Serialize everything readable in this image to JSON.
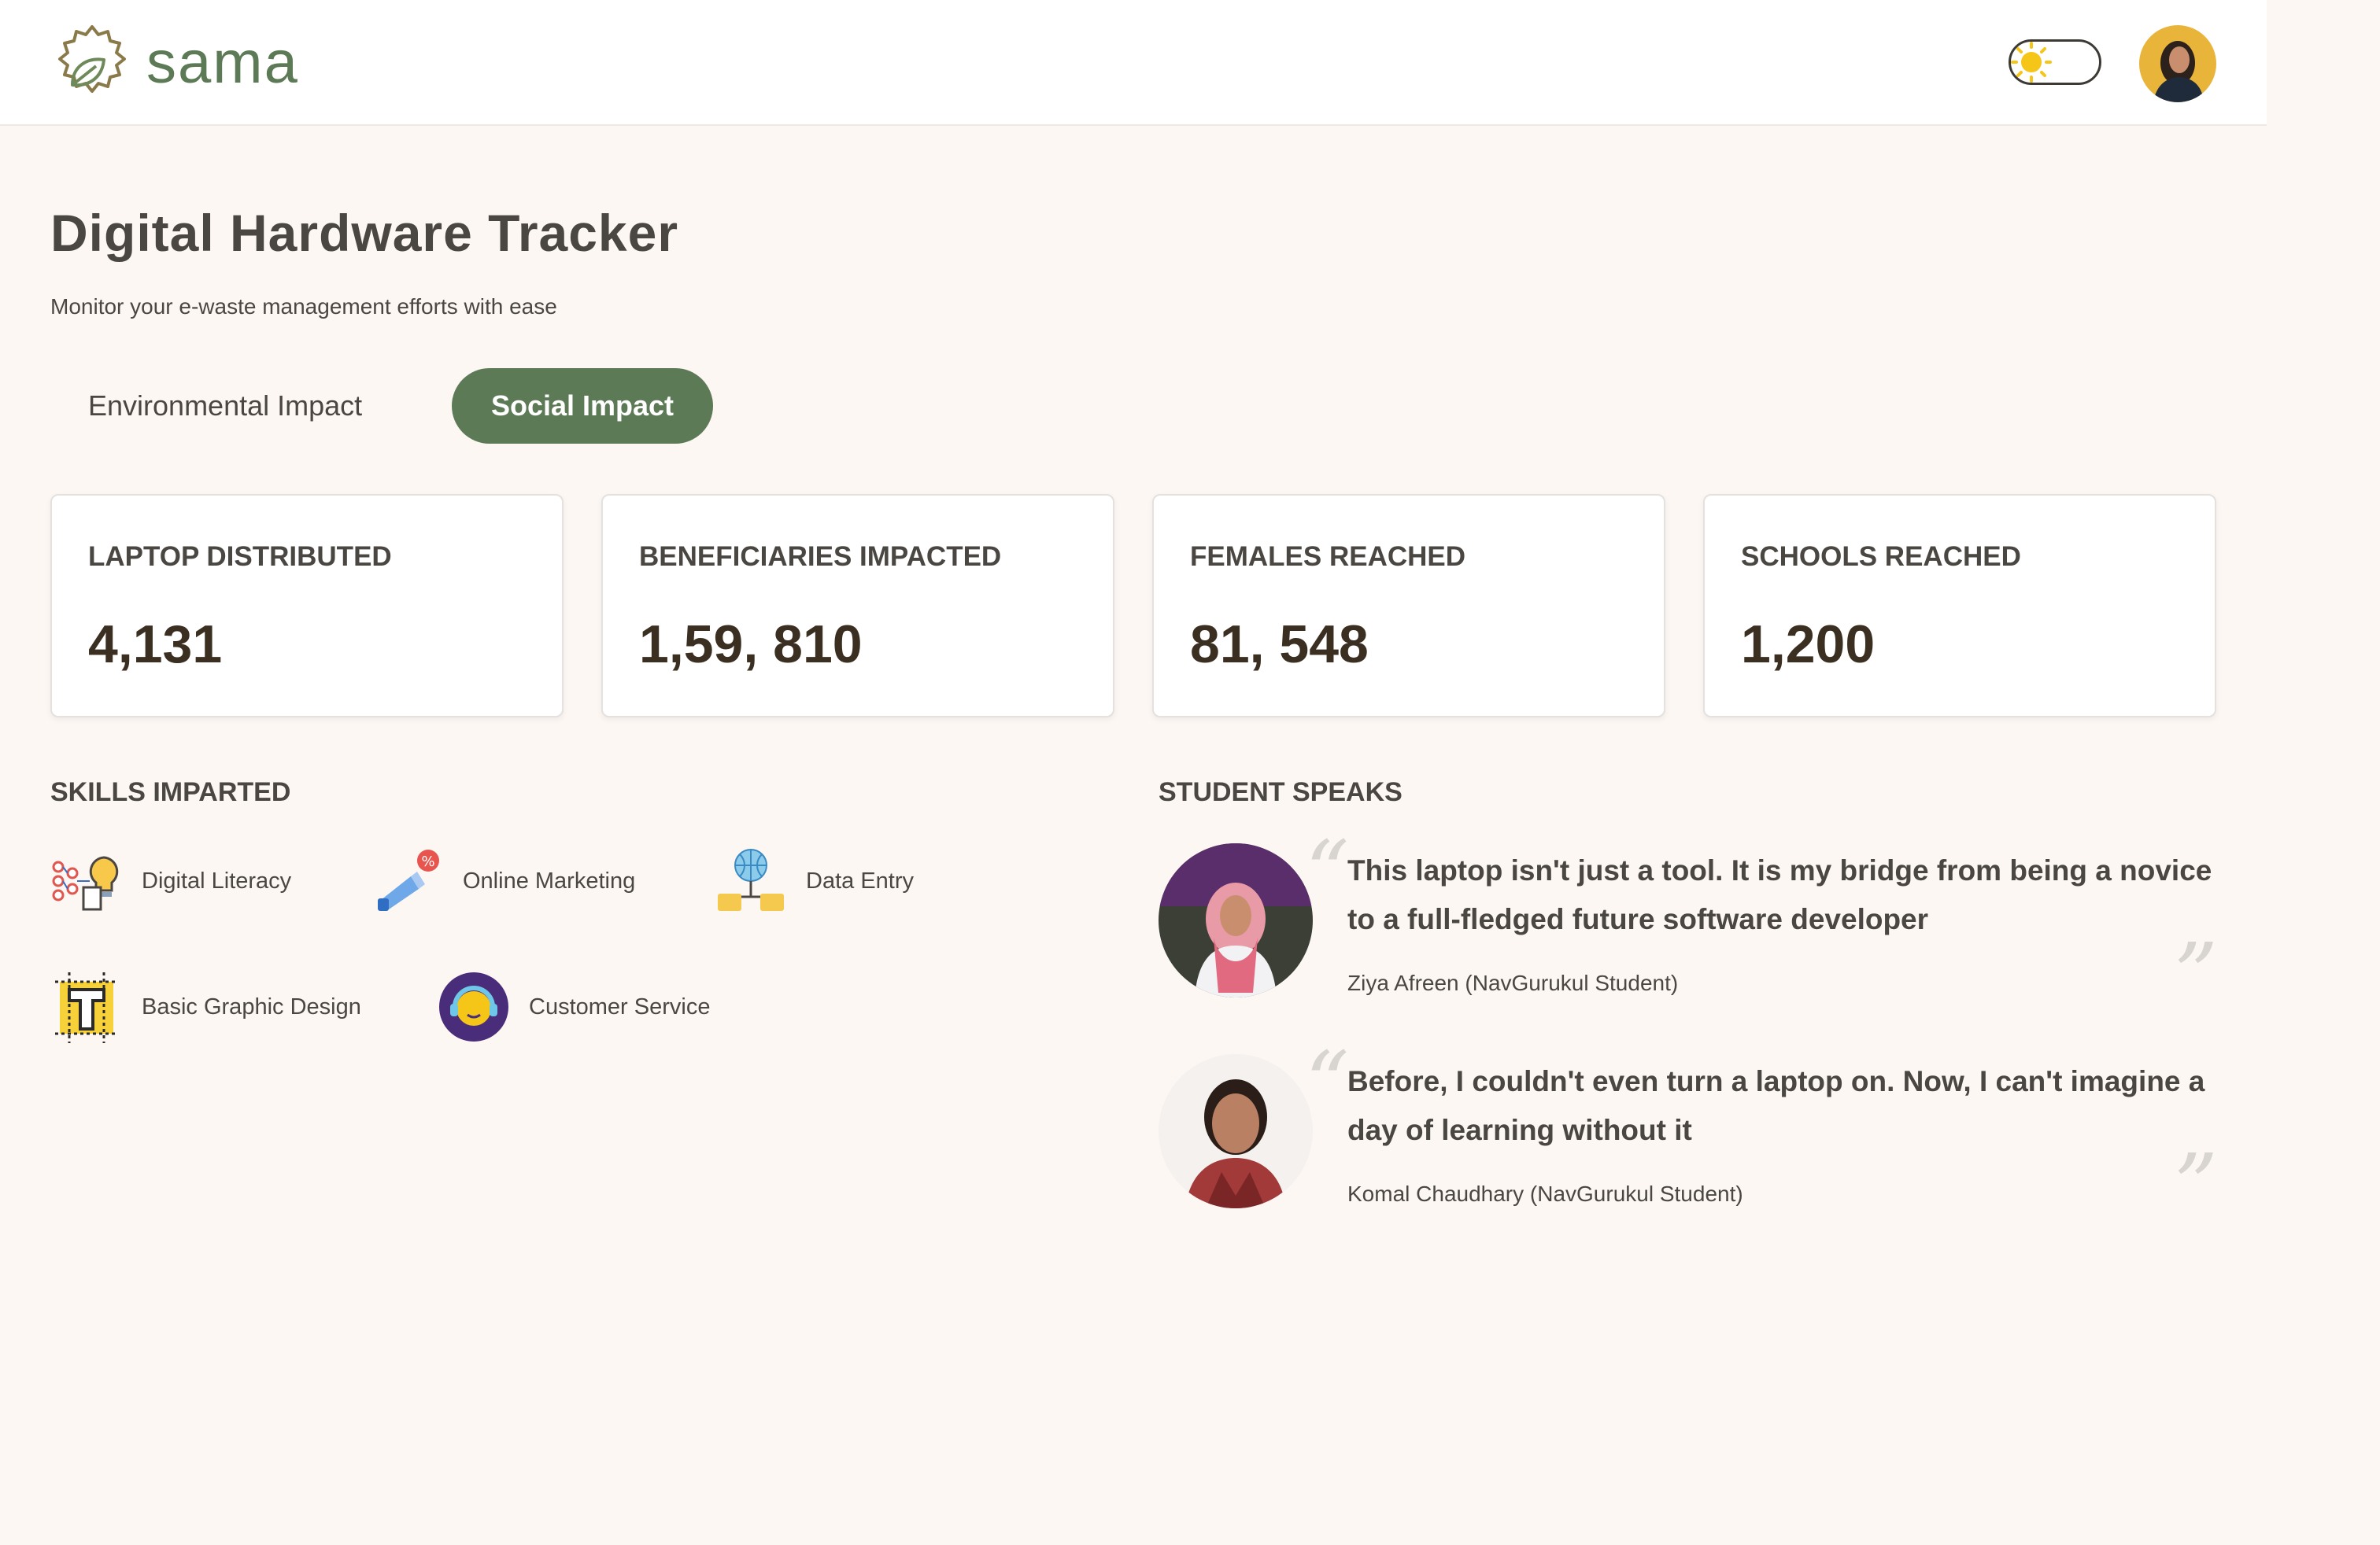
{
  "header": {
    "brand": "sama",
    "theme_toggle_icon": "sun-icon",
    "avatar_icon": "user-avatar"
  },
  "page": {
    "title": "Digital Hardware Tracker",
    "subtitle": "Monitor your e-waste management efforts with ease"
  },
  "tabs": [
    {
      "label": "Environmental Impact",
      "active": false
    },
    {
      "label": "Social Impact",
      "active": true
    }
  ],
  "stats": [
    {
      "label": "LAPTOP DISTRIBUTED",
      "value": "4,131"
    },
    {
      "label": "BENEFICIARIES IMPACTED",
      "value": "1,59, 810"
    },
    {
      "label": "FEMALES REACHED",
      "value": "81, 548"
    },
    {
      "label": "SCHOOLS REACHED",
      "value": "1,200"
    }
  ],
  "skills": {
    "title": "SKILLS IMPARTED",
    "items": [
      {
        "label": "Digital Literacy",
        "icon": "lightbulb-network-icon"
      },
      {
        "label": "Online Marketing",
        "icon": "megaphone-icon"
      },
      {
        "label": "Data Entry",
        "icon": "globe-folders-icon"
      },
      {
        "label": "Basic Graphic Design",
        "icon": "type-tool-icon"
      },
      {
        "label": "Customer Service",
        "icon": "headset-icon"
      }
    ]
  },
  "testimonials": {
    "title": "STUDENT SPEAKS",
    "items": [
      {
        "quote": "This laptop isn't just a tool. It is my bridge from being a novice to a full-fledged future software developer",
        "author": "Ziya Afreen (NavGurukul Student)"
      },
      {
        "quote": "Before, I couldn't even turn a laptop on. Now, I can't imagine a day of learning without it",
        "author": "Komal Chaudhary (NavGurukul Student)"
      }
    ]
  },
  "colors": {
    "brand_green": "#5d7a57",
    "background": "#fdf7f4",
    "value_text": "#3b2f22",
    "sun_yellow": "#f5c518"
  }
}
